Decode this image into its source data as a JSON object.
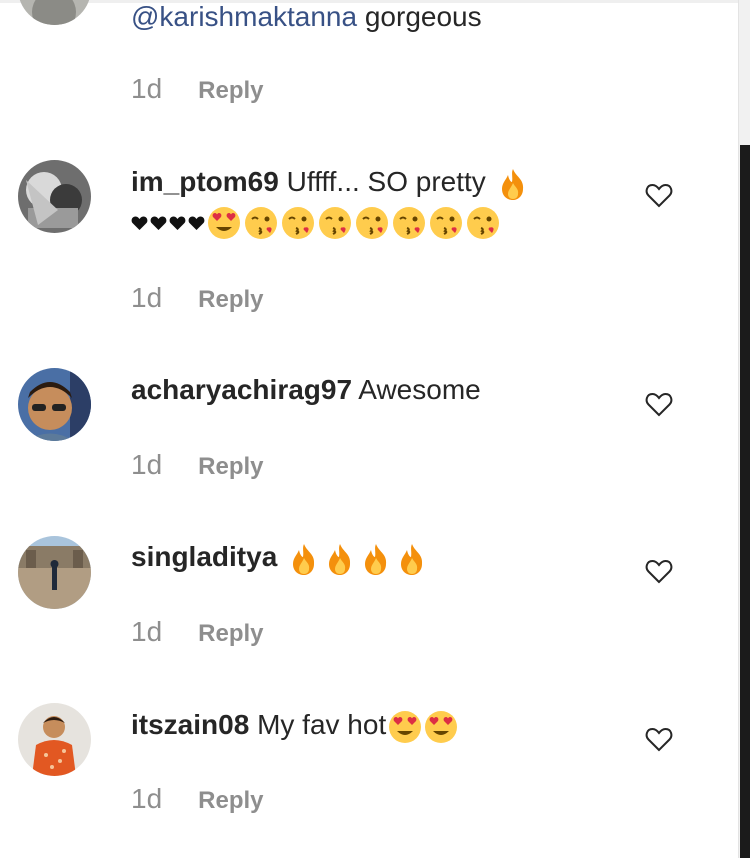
{
  "comments": [
    {
      "username": "",
      "mention": "@karishmaktanna",
      "text": "gorgeous",
      "time": "1d",
      "reply": "Reply"
    },
    {
      "username": "im_ptom69",
      "text": "Uffff... SO pretty",
      "emojis_inline": [
        "fire-emoji"
      ],
      "emojis_second_line": [
        "black-heart",
        "black-heart",
        "black-heart",
        "black-heart",
        "heart-eyes",
        "kiss-wink",
        "kiss-wink",
        "kiss-wink",
        "kiss-wink",
        "kiss-wink",
        "kiss-wink",
        "kiss-wink"
      ],
      "time": "1d",
      "reply": "Reply"
    },
    {
      "username": "acharyachirag97",
      "text": "Awesome",
      "time": "1d",
      "reply": "Reply"
    },
    {
      "username": "singladitya",
      "text": "",
      "emojis_inline": [
        "fire-emoji",
        "fire-emoji",
        "fire-emoji",
        "fire-emoji"
      ],
      "time": "1d",
      "reply": "Reply"
    },
    {
      "username": "itszain08",
      "text": "My fav hot",
      "emojis_inline": [
        "heart-eyes",
        "heart-eyes"
      ],
      "time": "1d",
      "reply": "Reply"
    }
  ],
  "colors": {
    "mention": "#385185",
    "meta": "#8e8e8e",
    "text": "#262626"
  }
}
